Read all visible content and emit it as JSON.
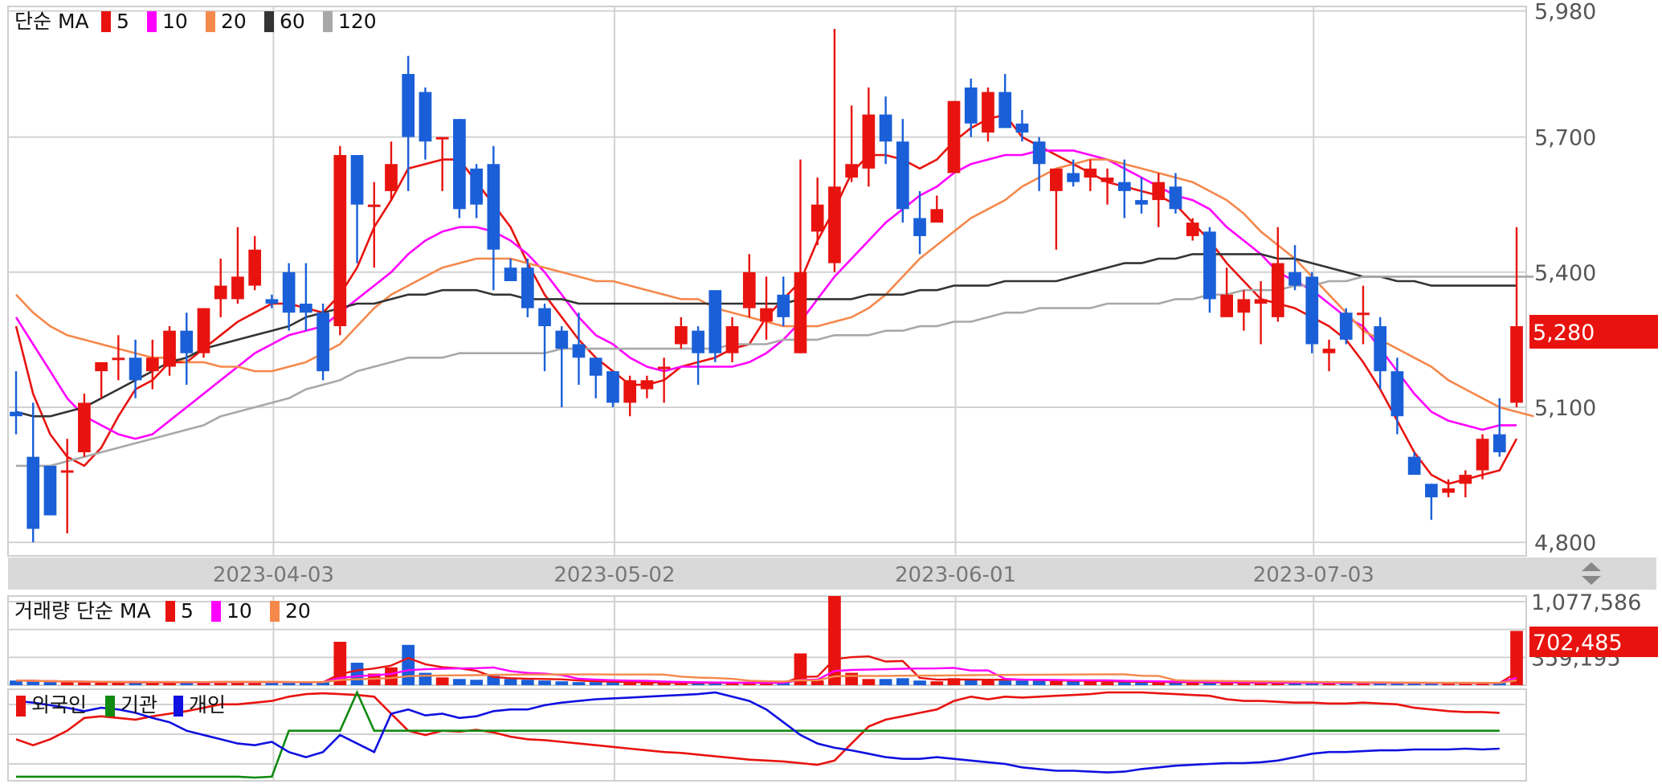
{
  "chart_data": {
    "type": "candlestick",
    "price_panel": {
      "legend": {
        "prefix": "단순 MA",
        "periods": [
          {
            "label": "5",
            "color": "#e8130f"
          },
          {
            "label": "10",
            "color": "#ff00ff"
          },
          {
            "label": "20",
            "color": "#f5884b"
          },
          {
            "label": "60",
            "color": "#333333"
          },
          {
            "label": "120",
            "color": "#a8a8a8"
          }
        ]
      },
      "y_ticks": [
        "5,980",
        "5,700",
        "5,400",
        "5,100",
        "4,800"
      ],
      "ylim": [
        4770,
        5990
      ],
      "current_price": "5,280",
      "x_date_labels": [
        {
          "label": "2023-04-03",
          "index": 15
        },
        {
          "label": "2023-05-02",
          "index": 35
        },
        {
          "label": "2023-06-01",
          "index": 55
        },
        {
          "label": "2023-07-03",
          "index": 76
        }
      ],
      "up_color": "#e8130f",
      "down_color": "#1a5fd8",
      "candles": [
        [
          5090,
          5080,
          5180,
          5040
        ],
        [
          4990,
          4830,
          5110,
          4800
        ],
        [
          4970,
          4860,
          4960,
          4860
        ],
        [
          4960,
          4960,
          5030,
          4820
        ],
        [
          5000,
          5110,
          5130,
          4990
        ],
        [
          5180,
          5200,
          5200,
          5120
        ],
        [
          5210,
          5210,
          5260,
          5160
        ],
        [
          5210,
          5160,
          5250,
          5120
        ],
        [
          5180,
          5210,
          5250,
          5140
        ],
        [
          5190,
          5270,
          5280,
          5170
        ],
        [
          5270,
          5220,
          5310,
          5150
        ],
        [
          5220,
          5320,
          5320,
          5210
        ],
        [
          5340,
          5370,
          5430,
          5300
        ],
        [
          5340,
          5390,
          5500,
          5330
        ],
        [
          5370,
          5450,
          5480,
          5360
        ],
        [
          5340,
          5330,
          5350,
          5320
        ],
        [
          5400,
          5310,
          5420,
          5270
        ],
        [
          5330,
          5310,
          5420,
          5270
        ],
        [
          5310,
          5180,
          5330,
          5160
        ],
        [
          5280,
          5660,
          5680,
          5260
        ],
        [
          5660,
          5550,
          5660,
          5420
        ],
        [
          5550,
          5550,
          5600,
          5410
        ],
        [
          5580,
          5640,
          5690,
          5560
        ],
        [
          5840,
          5700,
          5880,
          5580
        ],
        [
          5800,
          5690,
          5810,
          5650
        ],
        [
          5700,
          5700,
          5700,
          5580
        ],
        [
          5740,
          5540,
          5740,
          5520
        ],
        [
          5630,
          5550,
          5640,
          5520
        ],
        [
          5640,
          5450,
          5680,
          5360
        ],
        [
          5410,
          5380,
          5430,
          5380
        ],
        [
          5410,
          5320,
          5430,
          5300
        ],
        [
          5320,
          5280,
          5330,
          5180
        ],
        [
          5270,
          5230,
          5280,
          5100
        ],
        [
          5240,
          5210,
          5310,
          5150
        ],
        [
          5210,
          5170,
          5210,
          5120
        ],
        [
          5180,
          5110,
          5180,
          5100
        ],
        [
          5110,
          5160,
          5170,
          5080
        ],
        [
          5140,
          5160,
          5170,
          5120
        ],
        [
          5190,
          5190,
          5210,
          5110
        ],
        [
          5240,
          5280,
          5300,
          5230
        ],
        [
          5270,
          5220,
          5280,
          5150
        ],
        [
          5360,
          5220,
          5360,
          5200
        ],
        [
          5220,
          5280,
          5300,
          5200
        ],
        [
          5320,
          5400,
          5440,
          5300
        ],
        [
          5290,
          5320,
          5390,
          5250
        ],
        [
          5350,
          5300,
          5390,
          5280
        ],
        [
          5220,
          5400,
          5650,
          5220
        ],
        [
          5490,
          5550,
          5610,
          5460
        ],
        [
          5420,
          5590,
          5940,
          5400
        ],
        [
          5610,
          5640,
          5770,
          5600
        ],
        [
          5630,
          5750,
          5810,
          5590
        ],
        [
          5750,
          5690,
          5790,
          5640
        ],
        [
          5690,
          5540,
          5740,
          5510
        ],
        [
          5520,
          5480,
          5580,
          5440
        ],
        [
          5510,
          5540,
          5570,
          5520
        ],
        [
          5620,
          5780,
          5780,
          5620
        ],
        [
          5810,
          5730,
          5830,
          5700
        ],
        [
          5710,
          5800,
          5810,
          5690
        ],
        [
          5800,
          5720,
          5840,
          5720
        ],
        [
          5730,
          5710,
          5760,
          5690
        ],
        [
          5690,
          5640,
          5700,
          5580
        ],
        [
          5580,
          5630,
          5630,
          5450
        ],
        [
          5620,
          5600,
          5650,
          5590
        ],
        [
          5610,
          5630,
          5650,
          5580
        ],
        [
          5600,
          5610,
          5630,
          5550
        ],
        [
          5600,
          5580,
          5650,
          5520
        ],
        [
          5560,
          5550,
          5610,
          5530
        ],
        [
          5560,
          5600,
          5620,
          5500
        ],
        [
          5590,
          5540,
          5620,
          5530
        ],
        [
          5480,
          5510,
          5520,
          5470
        ],
        [
          5490,
          5340,
          5500,
          5310
        ],
        [
          5300,
          5350,
          5410,
          5300
        ],
        [
          5310,
          5340,
          5360,
          5270
        ],
        [
          5330,
          5340,
          5380,
          5240
        ],
        [
          5300,
          5420,
          5500,
          5290
        ],
        [
          5400,
          5370,
          5460,
          5360
        ],
        [
          5390,
          5240,
          5400,
          5220
        ],
        [
          5220,
          5230,
          5250,
          5180
        ],
        [
          5310,
          5250,
          5320,
          5240
        ],
        [
          5310,
          5310,
          5370,
          5240
        ],
        [
          5280,
          5180,
          5300,
          5140
        ],
        [
          5180,
          5080,
          5210,
          5040
        ],
        [
          4990,
          4950,
          5000,
          4950
        ],
        [
          4930,
          4900,
          4930,
          4850
        ],
        [
          4910,
          4920,
          4940,
          4900
        ],
        [
          4930,
          4950,
          4960,
          4900
        ],
        [
          4960,
          5030,
          5040,
          4940
        ],
        [
          5040,
          5000,
          5120,
          4990
        ],
        [
          5110,
          5280,
          5500,
          5100
        ]
      ],
      "ma": {
        "5": [
          5280,
          5130,
          5040,
          4990,
          4970,
          5010,
          5080,
          5140,
          5160,
          5200,
          5200,
          5230,
          5260,
          5290,
          5310,
          5330,
          5330,
          5320,
          5310,
          5350,
          5410,
          5500,
          5560,
          5630,
          5640,
          5650,
          5650,
          5600,
          5550,
          5500,
          5420,
          5350,
          5300,
          5250,
          5210,
          5180,
          5150,
          5150,
          5160,
          5190,
          5200,
          5210,
          5230,
          5240,
          5300,
          5340,
          5380,
          5470,
          5540,
          5620,
          5660,
          5660,
          5650,
          5630,
          5650,
          5690,
          5720,
          5740,
          5750,
          5700,
          5680,
          5660,
          5640,
          5620,
          5600,
          5590,
          5580,
          5570,
          5550,
          5510,
          5470,
          5420,
          5380,
          5340,
          5330,
          5320,
          5300,
          5280,
          5250,
          5200,
          5140,
          5070,
          5000,
          4950,
          4930,
          4940,
          4950,
          4960,
          5030
        ],
        "10": [
          5300,
          5240,
          5180,
          5120,
          5080,
          5060,
          5040,
          5030,
          5040,
          5070,
          5100,
          5130,
          5160,
          5190,
          5220,
          5240,
          5260,
          5270,
          5280,
          5310,
          5340,
          5370,
          5400,
          5440,
          5470,
          5490,
          5500,
          5500,
          5490,
          5470,
          5440,
          5400,
          5350,
          5300,
          5260,
          5240,
          5210,
          5190,
          5180,
          5190,
          5190,
          5190,
          5190,
          5200,
          5220,
          5250,
          5290,
          5340,
          5390,
          5430,
          5470,
          5510,
          5540,
          5570,
          5590,
          5620,
          5640,
          5650,
          5660,
          5660,
          5670,
          5670,
          5670,
          5660,
          5650,
          5630,
          5610,
          5590,
          5570,
          5560,
          5540,
          5500,
          5470,
          5440,
          5400,
          5380,
          5360,
          5330,
          5300,
          5280,
          5230,
          5180,
          5130,
          5090,
          5070,
          5060,
          5050,
          5060,
          5060
        ],
        "20": [
          5350,
          5310,
          5280,
          5260,
          5250,
          5240,
          5230,
          5220,
          5210,
          5210,
          5200,
          5200,
          5190,
          5190,
          5180,
          5180,
          5190,
          5200,
          5220,
          5240,
          5280,
          5320,
          5350,
          5370,
          5390,
          5410,
          5420,
          5430,
          5430,
          5430,
          5420,
          5410,
          5400,
          5390,
          5380,
          5380,
          5370,
          5360,
          5350,
          5340,
          5340,
          5320,
          5310,
          5300,
          5290,
          5280,
          5280,
          5280,
          5290,
          5300,
          5320,
          5350,
          5390,
          5430,
          5460,
          5490,
          5520,
          5540,
          5560,
          5590,
          5610,
          5630,
          5640,
          5650,
          5650,
          5640,
          5630,
          5620,
          5610,
          5600,
          5580,
          5560,
          5530,
          5490,
          5460,
          5430,
          5390,
          5350,
          5310,
          5270,
          5250,
          5230,
          5210,
          5190,
          5160,
          5140,
          5120,
          5100,
          5090,
          5080
        ],
        "60": [
          5090,
          5080,
          5080,
          5090,
          5100,
          5120,
          5140,
          5160,
          5180,
          5200,
          5210,
          5230,
          5240,
          5250,
          5260,
          5270,
          5280,
          5300,
          5310,
          5320,
          5330,
          5330,
          5340,
          5350,
          5350,
          5360,
          5360,
          5360,
          5350,
          5350,
          5340,
          5340,
          5340,
          5330,
          5330,
          5330,
          5330,
          5330,
          5330,
          5330,
          5330,
          5330,
          5330,
          5330,
          5330,
          5330,
          5340,
          5340,
          5340,
          5340,
          5350,
          5350,
          5350,
          5360,
          5360,
          5370,
          5370,
          5370,
          5380,
          5380,
          5380,
          5380,
          5390,
          5400,
          5410,
          5420,
          5420,
          5430,
          5430,
          5440,
          5440,
          5440,
          5440,
          5440,
          5430,
          5430,
          5420,
          5410,
          5400,
          5390,
          5390,
          5380,
          5380,
          5370,
          5370,
          5370,
          5370,
          5370,
          5370
        ],
        "120": [
          4970,
          4970,
          4970,
          4980,
          4990,
          5000,
          5010,
          5020,
          5030,
          5040,
          5050,
          5060,
          5080,
          5090,
          5100,
          5110,
          5120,
          5140,
          5150,
          5160,
          5180,
          5190,
          5200,
          5210,
          5210,
          5210,
          5220,
          5220,
          5220,
          5220,
          5220,
          5220,
          5230,
          5230,
          5230,
          5230,
          5230,
          5230,
          5230,
          5230,
          5230,
          5230,
          5240,
          5240,
          5240,
          5250,
          5250,
          5250,
          5260,
          5260,
          5260,
          5270,
          5270,
          5280,
          5280,
          5290,
          5290,
          5300,
          5310,
          5310,
          5320,
          5320,
          5320,
          5320,
          5330,
          5330,
          5330,
          5330,
          5340,
          5340,
          5350,
          5350,
          5360,
          5360,
          5360,
          5370,
          5370,
          5380,
          5380,
          5390,
          5390,
          5390,
          5390,
          5390,
          5390,
          5390,
          5390,
          5390,
          5390,
          5390
        ]
      }
    },
    "volume_panel": {
      "legend": {
        "prefix": "거래량 단순 MA",
        "periods": [
          {
            "label": "5",
            "color": "#e8130f"
          },
          {
            "label": "10",
            "color": "#ff00ff"
          },
          {
            "label": "20",
            "color": "#f5884b"
          }
        ]
      },
      "y_ticks": [
        "1,077,586",
        "359,195"
      ],
      "ylim": [
        0,
        1150000
      ],
      "current_volume": "702,485"
    },
    "investor_panel": {
      "legend": [
        {
          "label": "외국인",
          "color": "#e8130f"
        },
        {
          "label": "기관",
          "color": "#108a10"
        },
        {
          "label": "개인",
          "color": "#1010e0"
        }
      ]
    }
  },
  "ui": {
    "scroll_toggle": "updown-arrows-icon"
  }
}
